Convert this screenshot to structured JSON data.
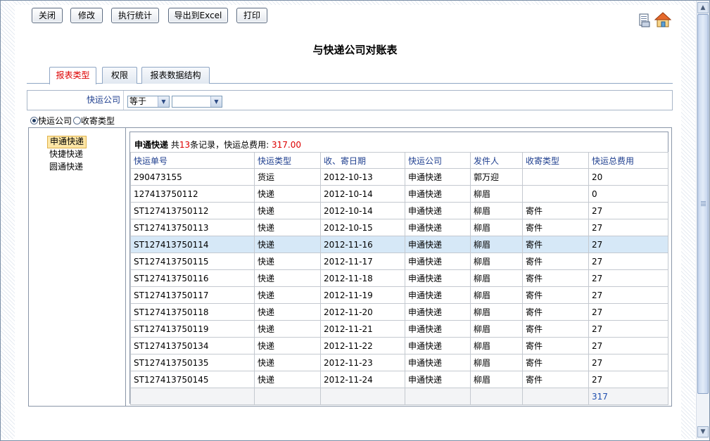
{
  "toolbar": {
    "close": "关闭",
    "edit": "修改",
    "run_stats": "执行统计",
    "export": "导出到Excel",
    "print": "打印"
  },
  "icons": {
    "print": "print-page-icon",
    "home": "home-icon"
  },
  "page_title": "与快递公司对账表",
  "tabs": [
    {
      "label": "报表类型",
      "active": true
    },
    {
      "label": "权限",
      "active": false
    },
    {
      "label": "报表数据结构",
      "active": false
    }
  ],
  "filter": {
    "label": "快运公司",
    "operator": "等于",
    "value": ""
  },
  "group_by": {
    "options": [
      "快运公司",
      "收寄类型"
    ],
    "selected": "快运公司"
  },
  "nav": {
    "items": [
      "申通快递",
      "快捷快递",
      "圆通快递"
    ],
    "selected": "申通快递"
  },
  "summary": {
    "company": "申通快递",
    "prefix": "共",
    "count": "13",
    "suffix": "条记录，快运总费用:",
    "total": "317.00"
  },
  "table": {
    "headers": [
      "快运单号",
      "快运类型",
      "收、寄日期",
      "快运公司",
      "发件人",
      "收寄类型",
      "快运总费用"
    ],
    "rows": [
      [
        "290473155",
        "货运",
        "2012-10-13",
        "申通快递",
        "郭万迎",
        "",
        "20"
      ],
      [
        "127413750112",
        "快递",
        "2012-10-14",
        "申通快递",
        "柳眉",
        "",
        "0"
      ],
      [
        "ST127413750112",
        "快递",
        "2012-10-14",
        "申通快递",
        "柳眉",
        "寄件",
        "27"
      ],
      [
        "ST127413750113",
        "快递",
        "2012-10-15",
        "申通快递",
        "柳眉",
        "寄件",
        "27"
      ],
      [
        "ST127413750114",
        "快递",
        "2012-11-16",
        "申通快递",
        "柳眉",
        "寄件",
        "27"
      ],
      [
        "ST127413750115",
        "快递",
        "2012-11-17",
        "申通快递",
        "柳眉",
        "寄件",
        "27"
      ],
      [
        "ST127413750116",
        "快递",
        "2012-11-18",
        "申通快递",
        "柳眉",
        "寄件",
        "27"
      ],
      [
        "ST127413750117",
        "快递",
        "2012-11-19",
        "申通快递",
        "柳眉",
        "寄件",
        "27"
      ],
      [
        "ST127413750118",
        "快递",
        "2012-11-20",
        "申通快递",
        "柳眉",
        "寄件",
        "27"
      ],
      [
        "ST127413750119",
        "快递",
        "2012-11-21",
        "申通快递",
        "柳眉",
        "寄件",
        "27"
      ],
      [
        "ST127413750134",
        "快递",
        "2012-11-22",
        "申通快递",
        "柳眉",
        "寄件",
        "27"
      ],
      [
        "ST127413750135",
        "快递",
        "2012-11-23",
        "申通快递",
        "柳眉",
        "寄件",
        "27"
      ],
      [
        "ST127413750145",
        "快递",
        "2012-11-24",
        "申通快递",
        "柳眉",
        "寄件",
        "27"
      ]
    ],
    "highlighted_row": 4,
    "total_row": [
      "",
      "",
      "",
      "",
      "",
      "",
      "317"
    ]
  },
  "colors": {
    "accent": "#1f3f8f",
    "highlight": "#d00000",
    "selected_row": "#d6e8f7"
  }
}
